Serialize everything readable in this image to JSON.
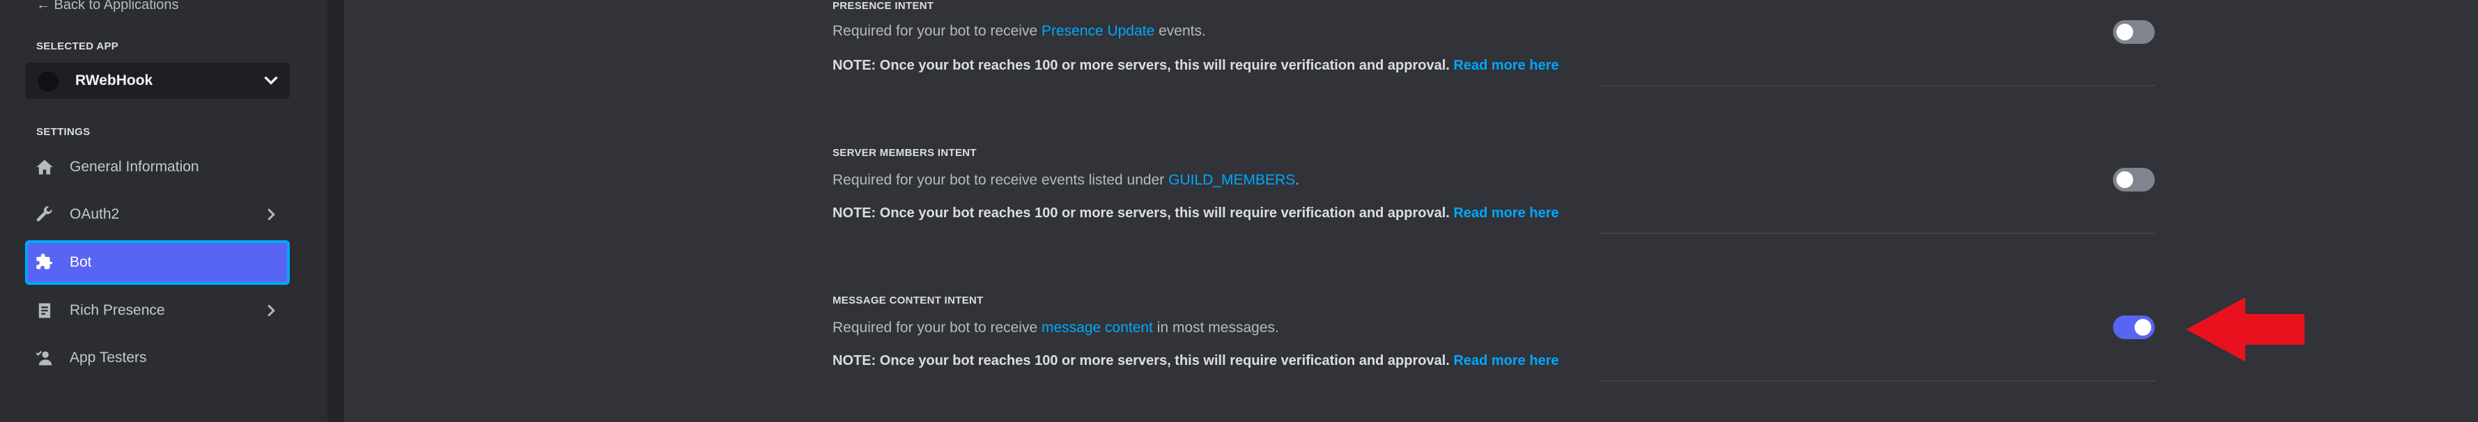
{
  "sidebar": {
    "back_link": "← Back to Applications",
    "selected_app_label": "SELECTED APP",
    "selected_app_name": "RWebHook",
    "settings_label": "SETTINGS",
    "items": [
      {
        "label": "General Information",
        "icon": "home-icon"
      },
      {
        "label": "OAuth2",
        "icon": "wrench-icon"
      },
      {
        "label": "Bot",
        "icon": "puzzle-icon",
        "active": true
      },
      {
        "label": "Rich Presence",
        "icon": "document-icon"
      },
      {
        "label": "App Testers",
        "icon": "user-check-icon"
      }
    ]
  },
  "intents": [
    {
      "title": "PRESENCE INTENT",
      "desc_before": "Required for your bot to receive ",
      "desc_link": "Presence Update",
      "desc_after": " events.",
      "note": "NOTE: Once your bot reaches 100 or more servers, this will require verification and approval.",
      "note_link": "Read more here",
      "enabled": false
    },
    {
      "title": "SERVER MEMBERS INTENT",
      "desc_before": "Required for your bot to receive events listed under ",
      "desc_link": "GUILD_MEMBERS",
      "desc_after": ".",
      "note": "NOTE: Once your bot reaches 100 or more servers, this will require verification and approval.",
      "note_link": "Read more here",
      "enabled": false
    },
    {
      "title": "MESSAGE CONTENT INTENT",
      "desc_before": "Required for your bot to receive ",
      "desc_link": "message content",
      "desc_after": " in most messages.",
      "note": "NOTE: Once your bot reaches 100 or more servers, this will require verification and approval.",
      "note_link": "Read more here",
      "enabled": true
    }
  ],
  "colors": {
    "accent": "#5865f2",
    "link": "#00a8fc",
    "annotation_arrow": "#e8121e"
  }
}
